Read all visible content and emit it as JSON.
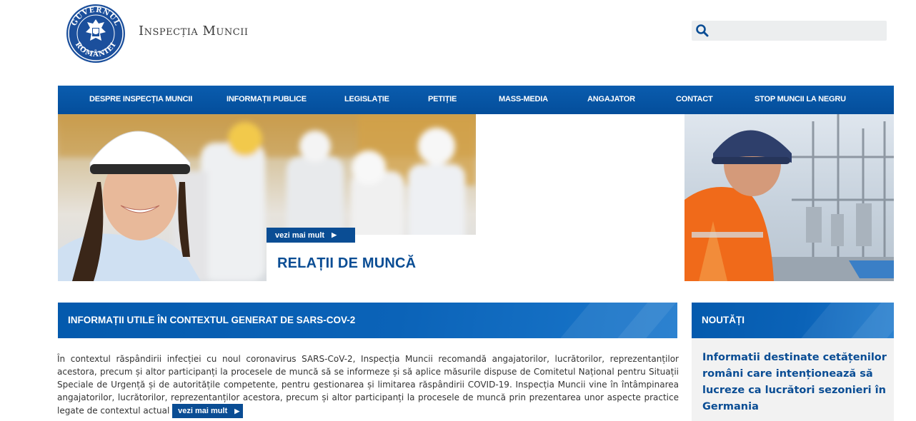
{
  "header": {
    "logo_text": "GUVERNUL ROMÂNIEI",
    "site_title": "Inspecția Muncii",
    "search": {
      "placeholder": "",
      "icon": "search-icon"
    }
  },
  "nav": {
    "items": [
      {
        "label": "DESPRE INSPECȚIA MUNCII"
      },
      {
        "label": "INFORMAȚII PUBLICE"
      },
      {
        "label": "LEGISLAȚIE"
      },
      {
        "label": "PETIȚIE"
      },
      {
        "label": "MASS-MEDIA"
      },
      {
        "label": "ANGAJATOR"
      },
      {
        "label": "CONTACT"
      },
      {
        "label": "STOP MUNCII LA NEGRU"
      }
    ]
  },
  "hero": {
    "more_label": "vezi mai mult",
    "caption": "RELAȚII DE MUNCĂ"
  },
  "covid": {
    "heading": "INFORMAȚII UTILE ÎN CONTEXTUL GENERAT DE SARS-COV-2",
    "body": "În contextul răspândirii infecției cu noul coronavirus SARS-CoV-2, Inspecția Muncii recomandă angajatorilor, lucrătorilor, reprezentanților acestora, precum și altor participanți la procesele de muncă să se informeze și să aplice măsurile dispuse de Comitetul Național pentru Situații Speciale de Urgență și de autoritățile competente, pentru gestionarea și limitarea răspândirii COVID-19. Inspecția Muncii vine în întâmpinarea angajatorilor, lucrătorilor, reprezentanților acestora, precum și altor participanți la procesele de muncă prin prezentarea unor aspecte practice legate de contextul actual",
    "more_label": "vezi mai mult"
  },
  "news": {
    "heading": "NOUTĂȚI",
    "item": "Informatii destinate cetățenilor români care intenționează să lucreze ca lucrători sezonieri în Germania"
  },
  "colors": {
    "brand_blue": "#0a4d94",
    "nav_blue": "#0a5cae"
  }
}
